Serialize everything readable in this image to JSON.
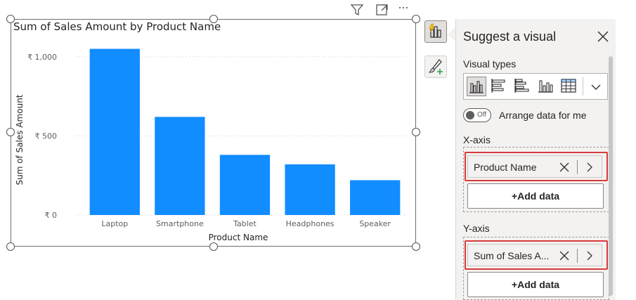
{
  "chart_data": {
    "type": "bar",
    "title": "Sum of Sales Amount by Product Name",
    "xlabel": "Product Name",
    "ylabel": "Sum of Sales Amount",
    "categories": [
      "Laptop",
      "Smartphone",
      "Tablet",
      "Headphones",
      "Speaker"
    ],
    "values": [
      1050,
      620,
      380,
      320,
      220
    ],
    "ylim": [
      0,
      1150
    ],
    "yticks": [
      0,
      500,
      1000
    ],
    "ytick_labels": [
      "₹ 0",
      "₹ 500",
      "₹ 1,000"
    ],
    "grid": true,
    "bar_color": "#118dff"
  },
  "header_icons": [
    "filter-icon",
    "focus-mode-icon",
    "more-options-icon"
  ],
  "header_more_label": "···",
  "pane": {
    "title": "Suggest a visual",
    "visual_types_label": "Visual types",
    "visual_types": [
      "clustered-column-icon",
      "stacked-bar-icon",
      "clustered-bar-icon",
      "column-line-icon",
      "table-icon"
    ],
    "toggle_state": "Off",
    "arrange_label": "Arrange data for me",
    "x_axis": {
      "label": "X-axis",
      "field": "Product Name",
      "add_label": "+Add data"
    },
    "y_axis": {
      "label": "Y-axis",
      "field": "Sum of Sales A...",
      "add_label": "+Add data"
    }
  },
  "colors": {
    "accent": "#118dff",
    "highlight": "#d83b3b",
    "pane_bg": "#f3f2f1"
  }
}
